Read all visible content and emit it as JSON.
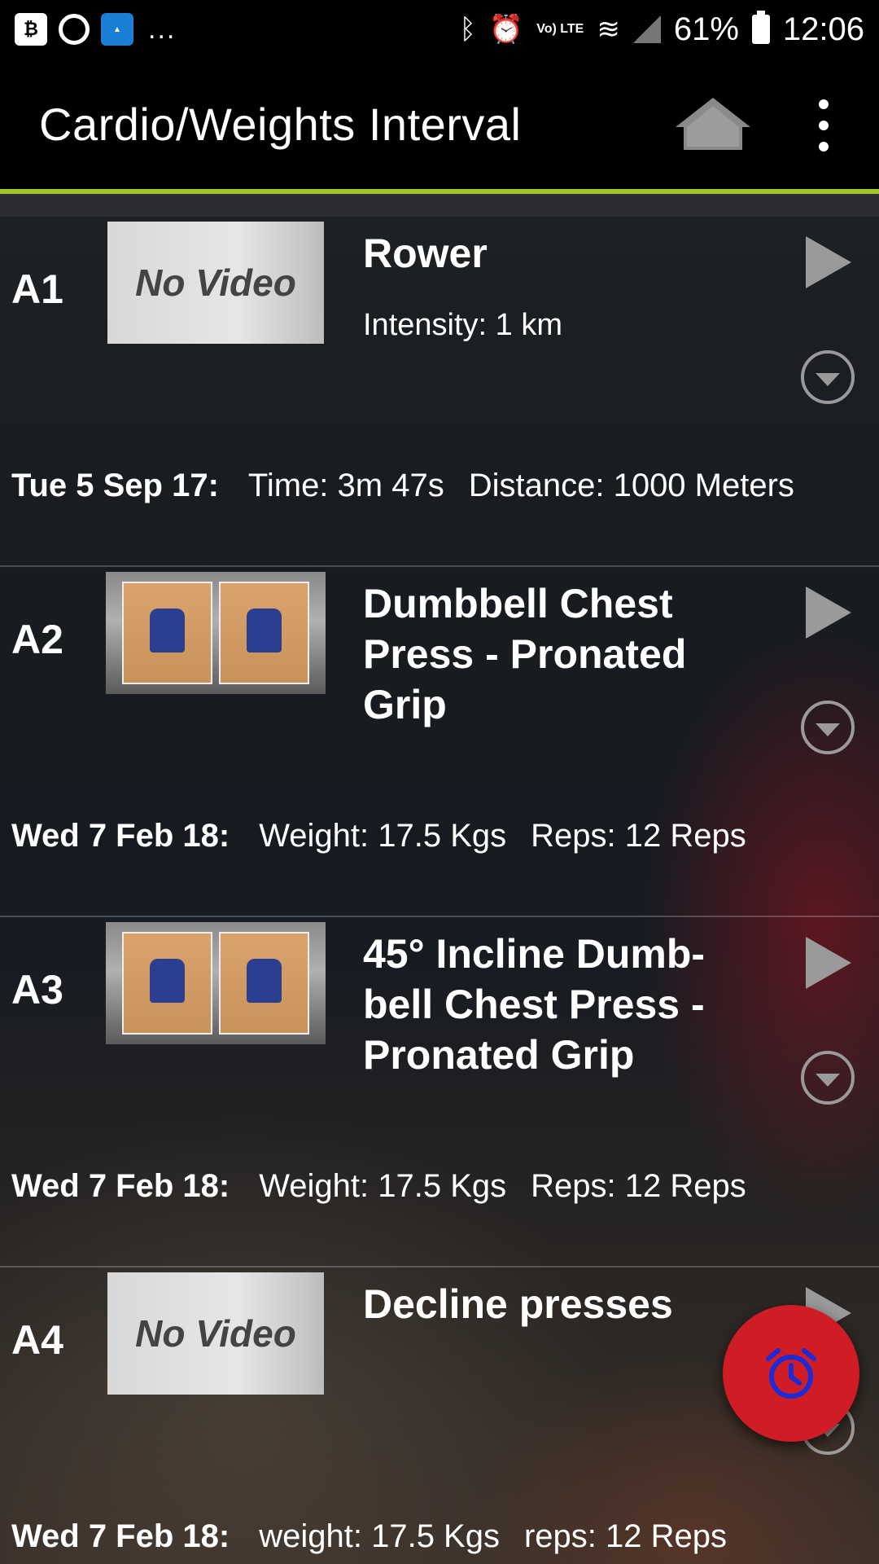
{
  "status_bar": {
    "overflow": "...",
    "battery": "61%",
    "time": "12:06",
    "network": "Vo) LTE"
  },
  "app_bar": {
    "title": "Cardio/Weights Interval"
  },
  "icons": {
    "home": "home-icon",
    "more": "more-vertical-icon",
    "play": "play-icon",
    "expand": "expand-circle-icon",
    "alarm": "alarm-clock-icon"
  },
  "colors": {
    "accent_line": "#9ec82a",
    "fab": "#d01c24",
    "fab_icon": "#1c2bd6"
  },
  "items": [
    {
      "index": "A1",
      "thumb": "No Video",
      "title": "Rower",
      "subtitle": "Intensity: 1 km",
      "date": "Tue 5 Sep 17:",
      "v1": "Time: 3m 47s",
      "v2": "Distance: 1000 Meters"
    },
    {
      "index": "A2",
      "title": "Dumbbell Chest Press - Pronated Grip",
      "date": "Wed 7 Feb 18:",
      "v1": "Weight: 17.5 Kgs",
      "v2": "Reps: 12 Reps"
    },
    {
      "index": "A3",
      "title": "45° Incline Dumb-bell Chest Press - Pronated Grip",
      "date": "Wed 7 Feb 18:",
      "v1": "Weight: 17.5 Kgs",
      "v2": "Reps: 12 Reps"
    },
    {
      "index": "A4",
      "thumb": "No Video",
      "title": "Decline presses",
      "date": "Wed 7 Feb 18:",
      "v1": "weight: 17.5 Kgs",
      "v2": "reps: 12 Reps"
    }
  ]
}
